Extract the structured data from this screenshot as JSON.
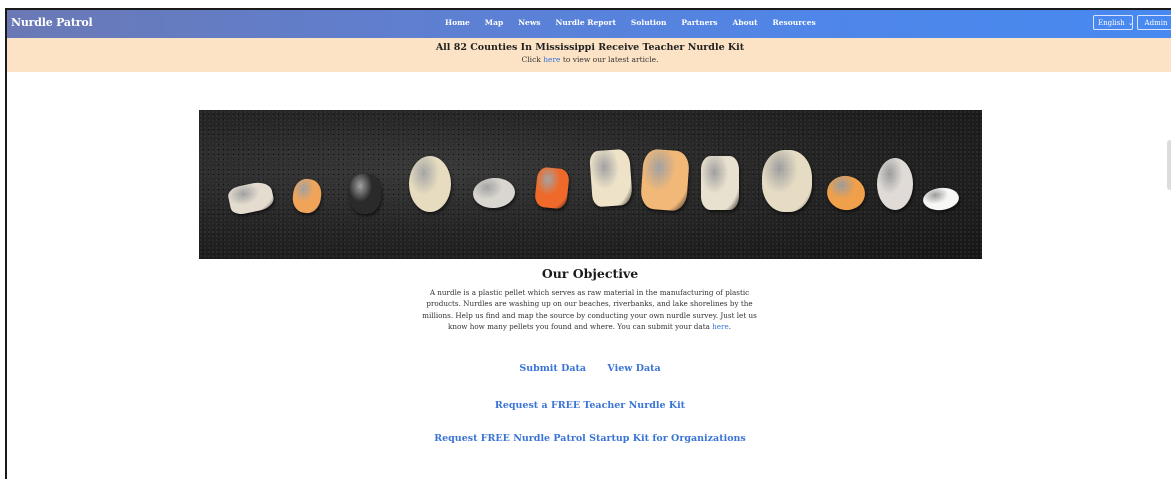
{
  "nav": {
    "brand": "Nurdle Patrol",
    "links": [
      "Home",
      "Map",
      "News",
      "Nurdle Report",
      "Solution",
      "Partners",
      "About",
      "Resources"
    ],
    "language": "English",
    "admin_label": "Admin"
  },
  "banner": {
    "title": "All 82 Counties In Mississippi Receive Teacher Nurdle Kit",
    "sub_prefix": "Click ",
    "sub_link": "here",
    "sub_suffix": " to view our latest article."
  },
  "hero": {
    "pellets": [
      {
        "color": "#e4ddcf"
      },
      {
        "color": "#f0a45a"
      },
      {
        "color": "#2a2a2a"
      },
      {
        "color": "#e7dcc0"
      },
      {
        "color": "#d9d6d0"
      },
      {
        "color": "#ef6a2a"
      },
      {
        "color": "#eee2c8"
      },
      {
        "color": "#f2b878"
      },
      {
        "color": "#e9e1cf"
      },
      {
        "color": "#e6dcc4"
      },
      {
        "color": "#f0a04a"
      },
      {
        "color": "#e0dbd6"
      },
      {
        "color": "#f7f7f5"
      }
    ]
  },
  "objective": {
    "title": "Our Objective",
    "text_main": "A nurdle is a plastic pellet which serves as raw material in the manufacturing of plastic products. Nurdles are washing up on our beaches, riverbanks, and lake shorelines by the millions. Help us find and map the source by conducting your own nurdle survey. Just let us know how many pellets you found and where. You can submit your data ",
    "text_link": "here",
    "text_end": "."
  },
  "actions": {
    "submit_data": "Submit Data",
    "view_data": "View Data",
    "teacher_kit": "Request a FREE Teacher Nurdle Kit",
    "org_kit": "Request FREE Nurdle Patrol Startup Kit for Organizations"
  },
  "colors": {
    "nav_start": "#6a79b5",
    "nav_end": "#4789f0",
    "banner_bg": "#fce3c6",
    "link": "#3a74d6"
  }
}
